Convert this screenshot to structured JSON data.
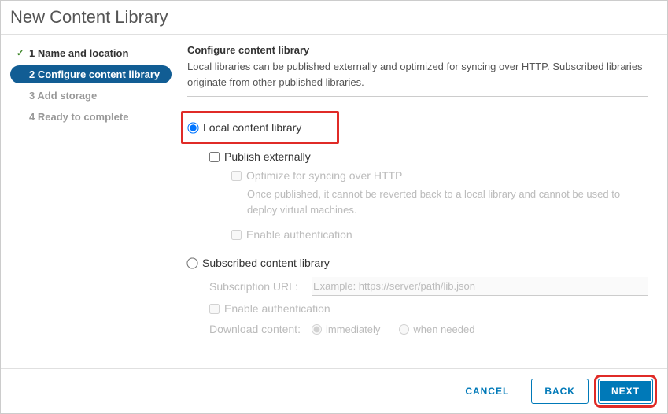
{
  "dialog": {
    "title": "New Content Library"
  },
  "steps": {
    "s1": "1 Name and location",
    "s2": "2 Configure content library",
    "s3": "3 Add storage",
    "s4": "4 Ready to complete"
  },
  "section": {
    "title": "Configure content library",
    "desc": "Local libraries can be published externally and optimized for syncing over HTTP. Subscribed libraries originate from other published libraries."
  },
  "options": {
    "local_label": "Local content library",
    "publish_externally": "Publish externally",
    "optimize_http": "Optimize for syncing over HTTP",
    "optimize_hint": "Once published, it cannot be reverted back to a local library and cannot be used to deploy virtual machines.",
    "enable_auth": "Enable authentication",
    "subscribed_label": "Subscribed content library",
    "subscription_url_label": "Subscription URL:",
    "subscription_url_placeholder": "Example: https://server/path/lib.json",
    "enable_auth2": "Enable authentication",
    "download_label": "Download content:",
    "download_immediately": "immediately",
    "download_when_needed": "when needed"
  },
  "buttons": {
    "cancel": "CANCEL",
    "back": "BACK",
    "next": "NEXT"
  }
}
